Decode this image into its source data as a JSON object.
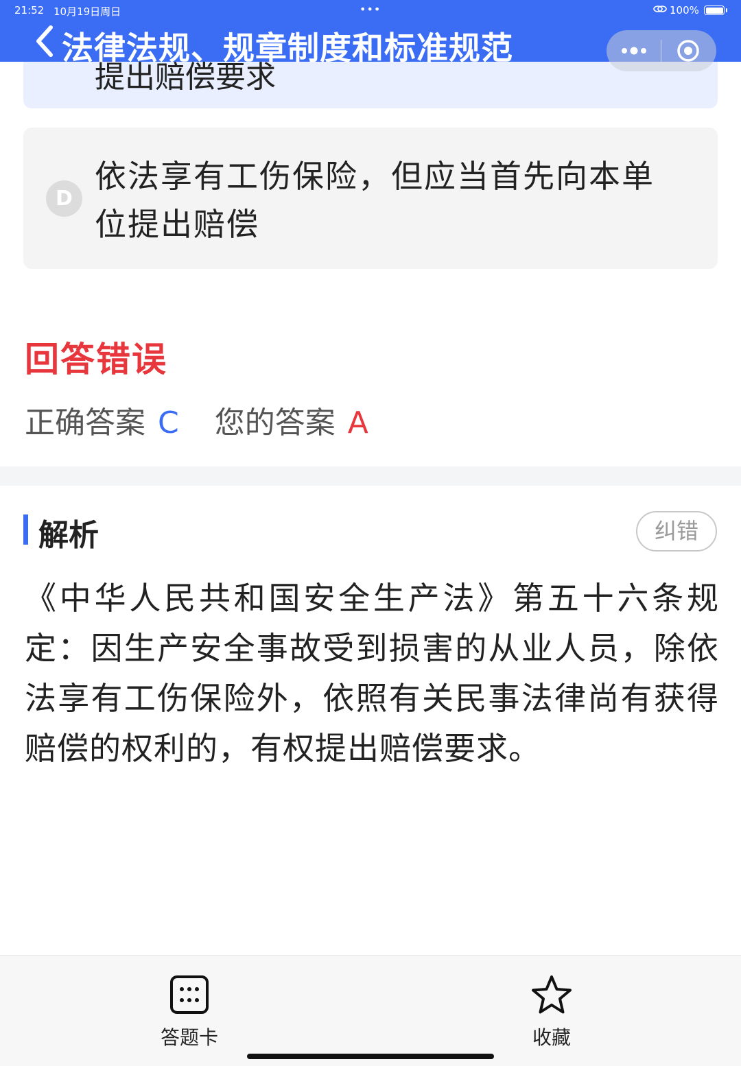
{
  "status_bar": {
    "time": "21:52",
    "date": "10月19日周日",
    "dots": "•••",
    "battery": "100%"
  },
  "header": {
    "title": "法律法规、规章制度和标准规范",
    "back_icon": "chevron-left-icon",
    "more_icon": "more-dots-icon",
    "close_icon": "target-icon"
  },
  "options": {
    "c_text_partial": "提出赔偿要求",
    "d_letter": "D",
    "d_text": "依法享有工伤保险，但应当首先向本单位提出赔偿"
  },
  "result": {
    "title": "回答错误",
    "correct_label": "正确答案",
    "correct_value": "C",
    "your_label": "您的答案",
    "your_value": "A"
  },
  "analysis": {
    "title": "解析",
    "report_button": "纠错",
    "text": "《中华人民共和国安全生产法》第五十六条规定：因生产安全事故受到损害的从业人员，除依法享有工伤保险外，依照有关民事法律尚有获得赔偿的权利的，有权提出赔偿要求。"
  },
  "tabbar": {
    "answer_card_label": "答题卡",
    "favorite_label": "收藏"
  },
  "colors": {
    "header": "#3a6cf4",
    "wrong": "#e8363d",
    "correct": "#3a6cf4"
  }
}
